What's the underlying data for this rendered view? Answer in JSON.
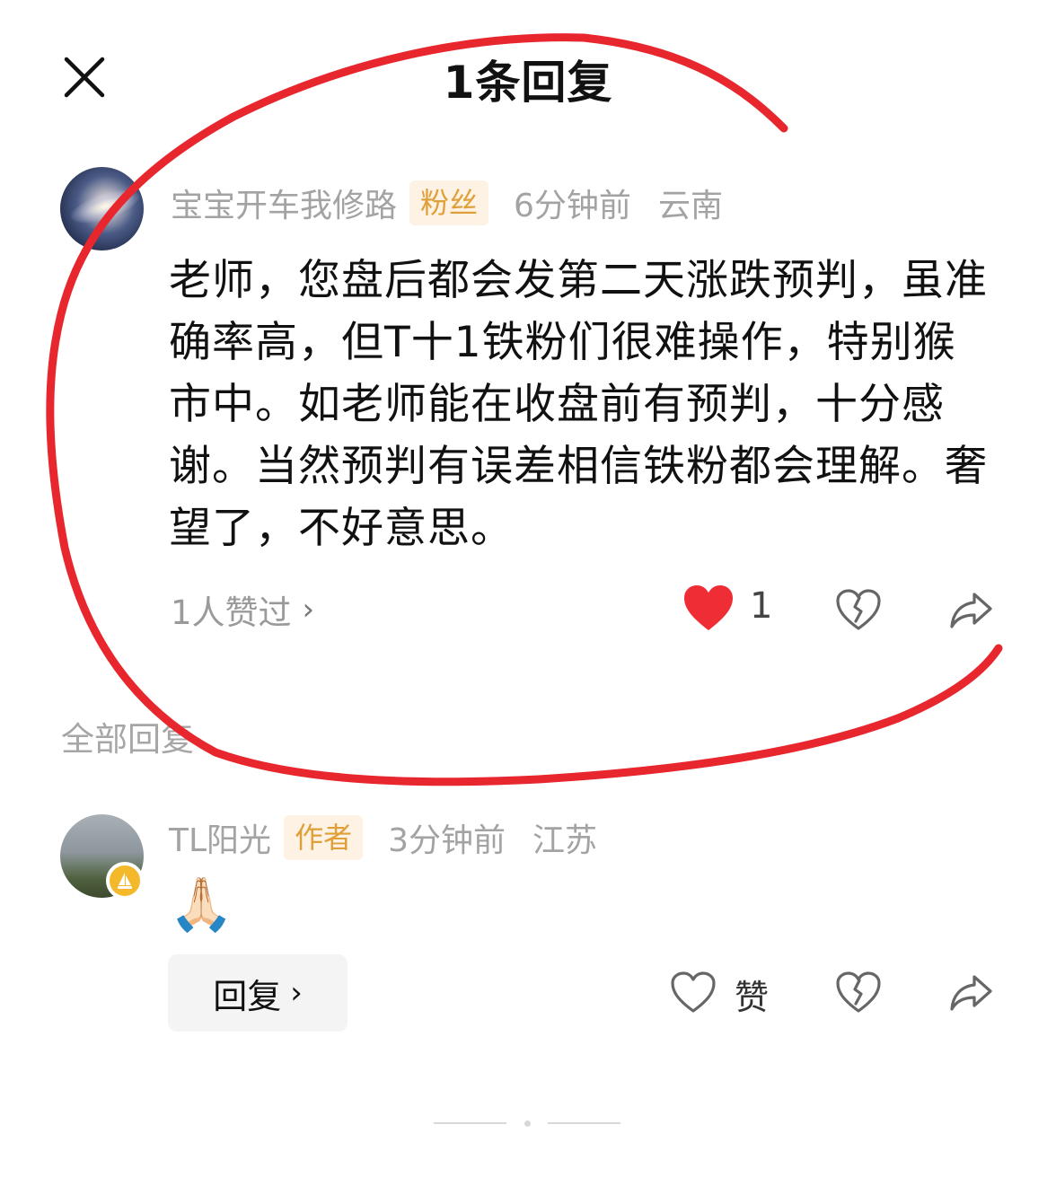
{
  "header": {
    "title": "1条回复",
    "close_icon": "close-icon"
  },
  "main_comment": {
    "username": "宝宝开车我修路",
    "tag": "粉丝",
    "time": "6分钟前",
    "location": "云南",
    "text": "老师，您盘后都会发第二天涨跌预判，虽准确率高，但T十1铁粉们很难操作，特别猴市中。如老师能在收盘前有预判，十分感谢。当然预判有误差相信铁粉都会理解。奢望了，不好意思。",
    "likes_text": "1人赞过",
    "like_count": "1",
    "icons": [
      "heart-filled-icon",
      "broken-heart-icon",
      "share-icon"
    ]
  },
  "section": {
    "all_replies": "全部回复"
  },
  "reply": {
    "username": "TL阳光",
    "tag": "作者",
    "time": "3分钟前",
    "location": "江苏",
    "emoji": "🙏🏻",
    "reply_button": "回复",
    "like_label": "赞",
    "icons": [
      "heart-outline-icon",
      "broken-heart-icon",
      "share-icon"
    ]
  },
  "colors": {
    "annotation_stroke": "#e8262d",
    "tag_bg": "#fdf2e3",
    "tag_text": "#e0a039",
    "heart_filled": "#ef2d35",
    "author_badge": "#f3b92b"
  }
}
